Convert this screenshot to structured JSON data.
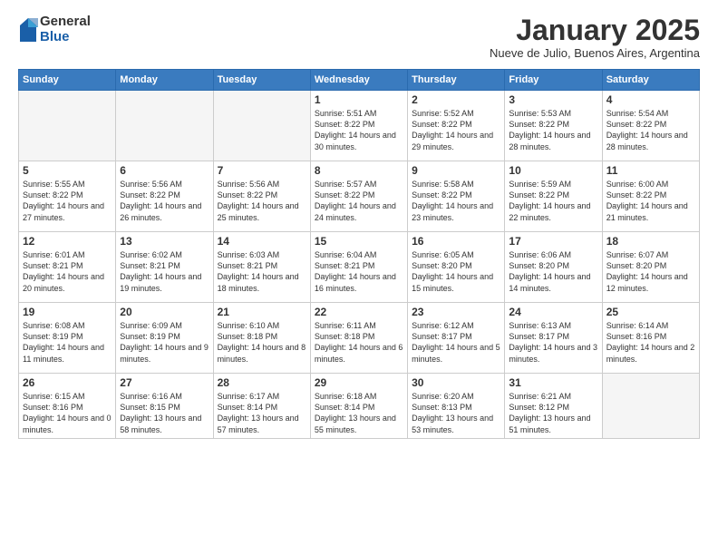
{
  "logo": {
    "general": "General",
    "blue": "Blue"
  },
  "header": {
    "title": "January 2025",
    "subtitle": "Nueve de Julio, Buenos Aires, Argentina"
  },
  "weekdays": [
    "Sunday",
    "Monday",
    "Tuesday",
    "Wednesday",
    "Thursday",
    "Friday",
    "Saturday"
  ],
  "weeks": [
    [
      {
        "day": "",
        "empty": true
      },
      {
        "day": "",
        "empty": true
      },
      {
        "day": "",
        "empty": true
      },
      {
        "day": "1",
        "sunrise": "5:51 AM",
        "sunset": "8:22 PM",
        "daylight": "14 hours and 30 minutes."
      },
      {
        "day": "2",
        "sunrise": "5:52 AM",
        "sunset": "8:22 PM",
        "daylight": "14 hours and 29 minutes."
      },
      {
        "day": "3",
        "sunrise": "5:53 AM",
        "sunset": "8:22 PM",
        "daylight": "14 hours and 28 minutes."
      },
      {
        "day": "4",
        "sunrise": "5:54 AM",
        "sunset": "8:22 PM",
        "daylight": "14 hours and 28 minutes."
      }
    ],
    [
      {
        "day": "5",
        "sunrise": "5:55 AM",
        "sunset": "8:22 PM",
        "daylight": "14 hours and 27 minutes."
      },
      {
        "day": "6",
        "sunrise": "5:56 AM",
        "sunset": "8:22 PM",
        "daylight": "14 hours and 26 minutes."
      },
      {
        "day": "7",
        "sunrise": "5:56 AM",
        "sunset": "8:22 PM",
        "daylight": "14 hours and 25 minutes."
      },
      {
        "day": "8",
        "sunrise": "5:57 AM",
        "sunset": "8:22 PM",
        "daylight": "14 hours and 24 minutes."
      },
      {
        "day": "9",
        "sunrise": "5:58 AM",
        "sunset": "8:22 PM",
        "daylight": "14 hours and 23 minutes."
      },
      {
        "day": "10",
        "sunrise": "5:59 AM",
        "sunset": "8:22 PM",
        "daylight": "14 hours and 22 minutes."
      },
      {
        "day": "11",
        "sunrise": "6:00 AM",
        "sunset": "8:22 PM",
        "daylight": "14 hours and 21 minutes."
      }
    ],
    [
      {
        "day": "12",
        "sunrise": "6:01 AM",
        "sunset": "8:21 PM",
        "daylight": "14 hours and 20 minutes."
      },
      {
        "day": "13",
        "sunrise": "6:02 AM",
        "sunset": "8:21 PM",
        "daylight": "14 hours and 19 minutes."
      },
      {
        "day": "14",
        "sunrise": "6:03 AM",
        "sunset": "8:21 PM",
        "daylight": "14 hours and 18 minutes."
      },
      {
        "day": "15",
        "sunrise": "6:04 AM",
        "sunset": "8:21 PM",
        "daylight": "14 hours and 16 minutes."
      },
      {
        "day": "16",
        "sunrise": "6:05 AM",
        "sunset": "8:20 PM",
        "daylight": "14 hours and 15 minutes."
      },
      {
        "day": "17",
        "sunrise": "6:06 AM",
        "sunset": "8:20 PM",
        "daylight": "14 hours and 14 minutes."
      },
      {
        "day": "18",
        "sunrise": "6:07 AM",
        "sunset": "8:20 PM",
        "daylight": "14 hours and 12 minutes."
      }
    ],
    [
      {
        "day": "19",
        "sunrise": "6:08 AM",
        "sunset": "8:19 PM",
        "daylight": "14 hours and 11 minutes."
      },
      {
        "day": "20",
        "sunrise": "6:09 AM",
        "sunset": "8:19 PM",
        "daylight": "14 hours and 9 minutes."
      },
      {
        "day": "21",
        "sunrise": "6:10 AM",
        "sunset": "8:18 PM",
        "daylight": "14 hours and 8 minutes."
      },
      {
        "day": "22",
        "sunrise": "6:11 AM",
        "sunset": "8:18 PM",
        "daylight": "14 hours and 6 minutes."
      },
      {
        "day": "23",
        "sunrise": "6:12 AM",
        "sunset": "8:17 PM",
        "daylight": "14 hours and 5 minutes."
      },
      {
        "day": "24",
        "sunrise": "6:13 AM",
        "sunset": "8:17 PM",
        "daylight": "14 hours and 3 minutes."
      },
      {
        "day": "25",
        "sunrise": "6:14 AM",
        "sunset": "8:16 PM",
        "daylight": "14 hours and 2 minutes."
      }
    ],
    [
      {
        "day": "26",
        "sunrise": "6:15 AM",
        "sunset": "8:16 PM",
        "daylight": "14 hours and 0 minutes."
      },
      {
        "day": "27",
        "sunrise": "6:16 AM",
        "sunset": "8:15 PM",
        "daylight": "13 hours and 58 minutes."
      },
      {
        "day": "28",
        "sunrise": "6:17 AM",
        "sunset": "8:14 PM",
        "daylight": "13 hours and 57 minutes."
      },
      {
        "day": "29",
        "sunrise": "6:18 AM",
        "sunset": "8:14 PM",
        "daylight": "13 hours and 55 minutes."
      },
      {
        "day": "30",
        "sunrise": "6:20 AM",
        "sunset": "8:13 PM",
        "daylight": "13 hours and 53 minutes."
      },
      {
        "day": "31",
        "sunrise": "6:21 AM",
        "sunset": "8:12 PM",
        "daylight": "13 hours and 51 minutes."
      },
      {
        "day": "",
        "empty": true
      }
    ]
  ]
}
